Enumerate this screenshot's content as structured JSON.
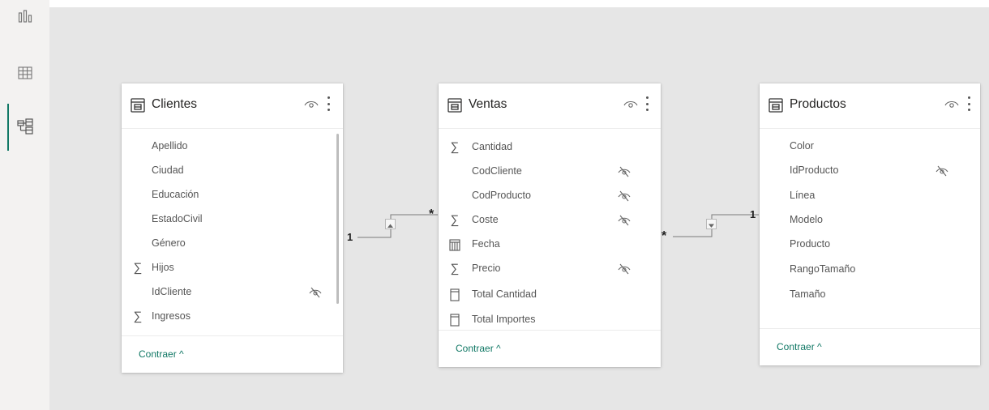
{
  "colors": {
    "accent": "#117865",
    "canvas": "#e6e6e6"
  },
  "rail": {
    "items": [
      {
        "name": "report-view",
        "icon": "bar-chart-icon"
      },
      {
        "name": "data-view",
        "icon": "table-grid-icon"
      },
      {
        "name": "model-view",
        "icon": "model-diagram-icon",
        "active": true
      }
    ]
  },
  "tables": {
    "clientes": {
      "title": "Clientes",
      "collapse_label": "Contraer ^",
      "fields": [
        {
          "name": "Apellido",
          "icon": "",
          "hidden": false
        },
        {
          "name": "Ciudad",
          "icon": "",
          "hidden": false
        },
        {
          "name": "Educación",
          "icon": "",
          "hidden": false
        },
        {
          "name": "EstadoCivil",
          "icon": "",
          "hidden": false
        },
        {
          "name": "Género",
          "icon": "",
          "hidden": false
        },
        {
          "name": "Hijos",
          "icon": "sum-icon",
          "hidden": false
        },
        {
          "name": "IdCliente",
          "icon": "",
          "hidden": true
        },
        {
          "name": "Ingresos",
          "icon": "sum-icon",
          "hidden": false
        }
      ]
    },
    "ventas": {
      "title": "Ventas",
      "collapse_label": "Contraer ^",
      "fields": [
        {
          "name": "Cantidad",
          "icon": "sum-icon",
          "hidden": false
        },
        {
          "name": "CodCliente",
          "icon": "",
          "hidden": true
        },
        {
          "name": "CodProducto",
          "icon": "",
          "hidden": true
        },
        {
          "name": "Coste",
          "icon": "sum-icon",
          "hidden": true
        },
        {
          "name": "Fecha",
          "icon": "calendar-icon",
          "hidden": false
        },
        {
          "name": "Precio",
          "icon": "sum-icon",
          "hidden": true
        },
        {
          "name": "Total Cantidad",
          "icon": "measure-icon",
          "hidden": false
        },
        {
          "name": "Total Importes",
          "icon": "measure-icon",
          "hidden": false
        }
      ]
    },
    "productos": {
      "title": "Productos",
      "collapse_label": "Contraer ^",
      "fields": [
        {
          "name": "Color",
          "icon": "",
          "hidden": false
        },
        {
          "name": "IdProducto",
          "icon": "",
          "hidden": true
        },
        {
          "name": "Línea",
          "icon": "",
          "hidden": false
        },
        {
          "name": "Modelo",
          "icon": "",
          "hidden": false
        },
        {
          "name": "Producto",
          "icon": "",
          "hidden": false
        },
        {
          "name": "RangoTamaño",
          "icon": "",
          "hidden": false
        },
        {
          "name": "Tamaño",
          "icon": "",
          "hidden": false
        }
      ]
    }
  },
  "relationships": [
    {
      "from": "Clientes",
      "to": "Ventas",
      "one_label": "1",
      "many_label": "*",
      "filter_icon": "triangle-up-icon"
    },
    {
      "from": "Ventas",
      "to": "Productos",
      "many_label": "*",
      "one_label": "1",
      "filter_icon": "triangle-down-icon"
    }
  ]
}
